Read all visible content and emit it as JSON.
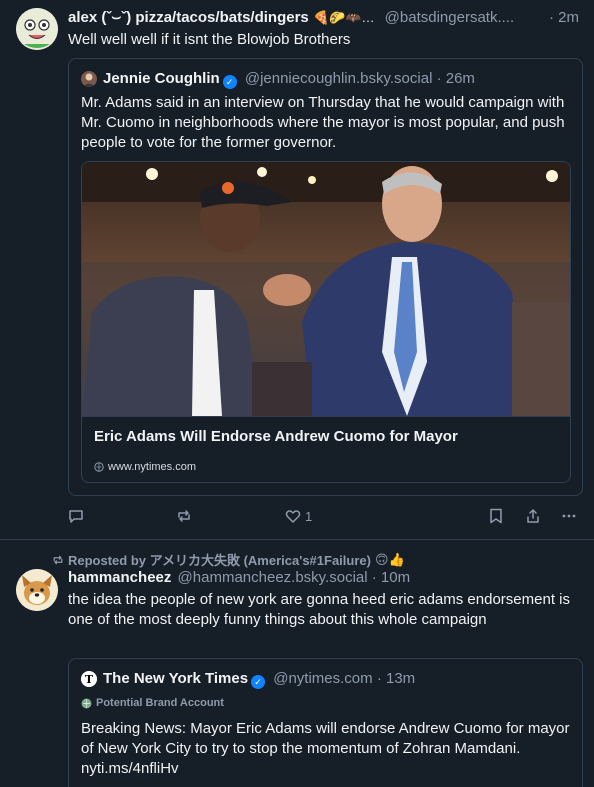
{
  "post1": {
    "display_name": "alex (ˇ⌣ˇ) pizza/tacos/bats/dingers",
    "emoji": "🍕🌮🦇…",
    "handle": "@batsdingersatk....",
    "time": "· 2m",
    "text": "Well well well if it isnt the Blowjob Brothers",
    "quote": {
      "display_name": "Jennie Coughlin",
      "handle": "@jenniecoughlin.bsky.social",
      "time": "· 26m",
      "text": "Mr. Adams said in an interview on Thursday that he would campaign with Mr. Cuomo in neighborhoods where the mayor is most popular, and push people to vote for the former governor.",
      "card_title": "Eric Adams Will Endorse Andrew Cuomo for Mayor",
      "card_domain": "www.nytimes.com"
    },
    "like_count": "1"
  },
  "post2": {
    "repost_label": "Reposted by アメリカ大失敗 (America's#1Failure)",
    "repost_emoji": "🙃👍",
    "display_name": "hammancheez",
    "handle": "@hammancheez.bsky.social",
    "time": "· 10m",
    "text": "the idea the people of new york are gonna heed eric adams endorsement is one of the most deeply funny things about this whole campaign",
    "quote": {
      "display_name": "The New York Times",
      "handle": "@nytimes.com",
      "time": "· 13m",
      "badge": "Potential Brand Account",
      "text": "Breaking News: Mayor Eric Adams will endorse Andrew Cuomo for mayor of New York City to try to stop the momentum of Zohran Mamdani. nyti.ms/4nfliHv"
    }
  },
  "colors": {
    "background": "#161e27",
    "border": "#2e4052",
    "muted": "#8d9bad",
    "verified": "#1083fe"
  }
}
